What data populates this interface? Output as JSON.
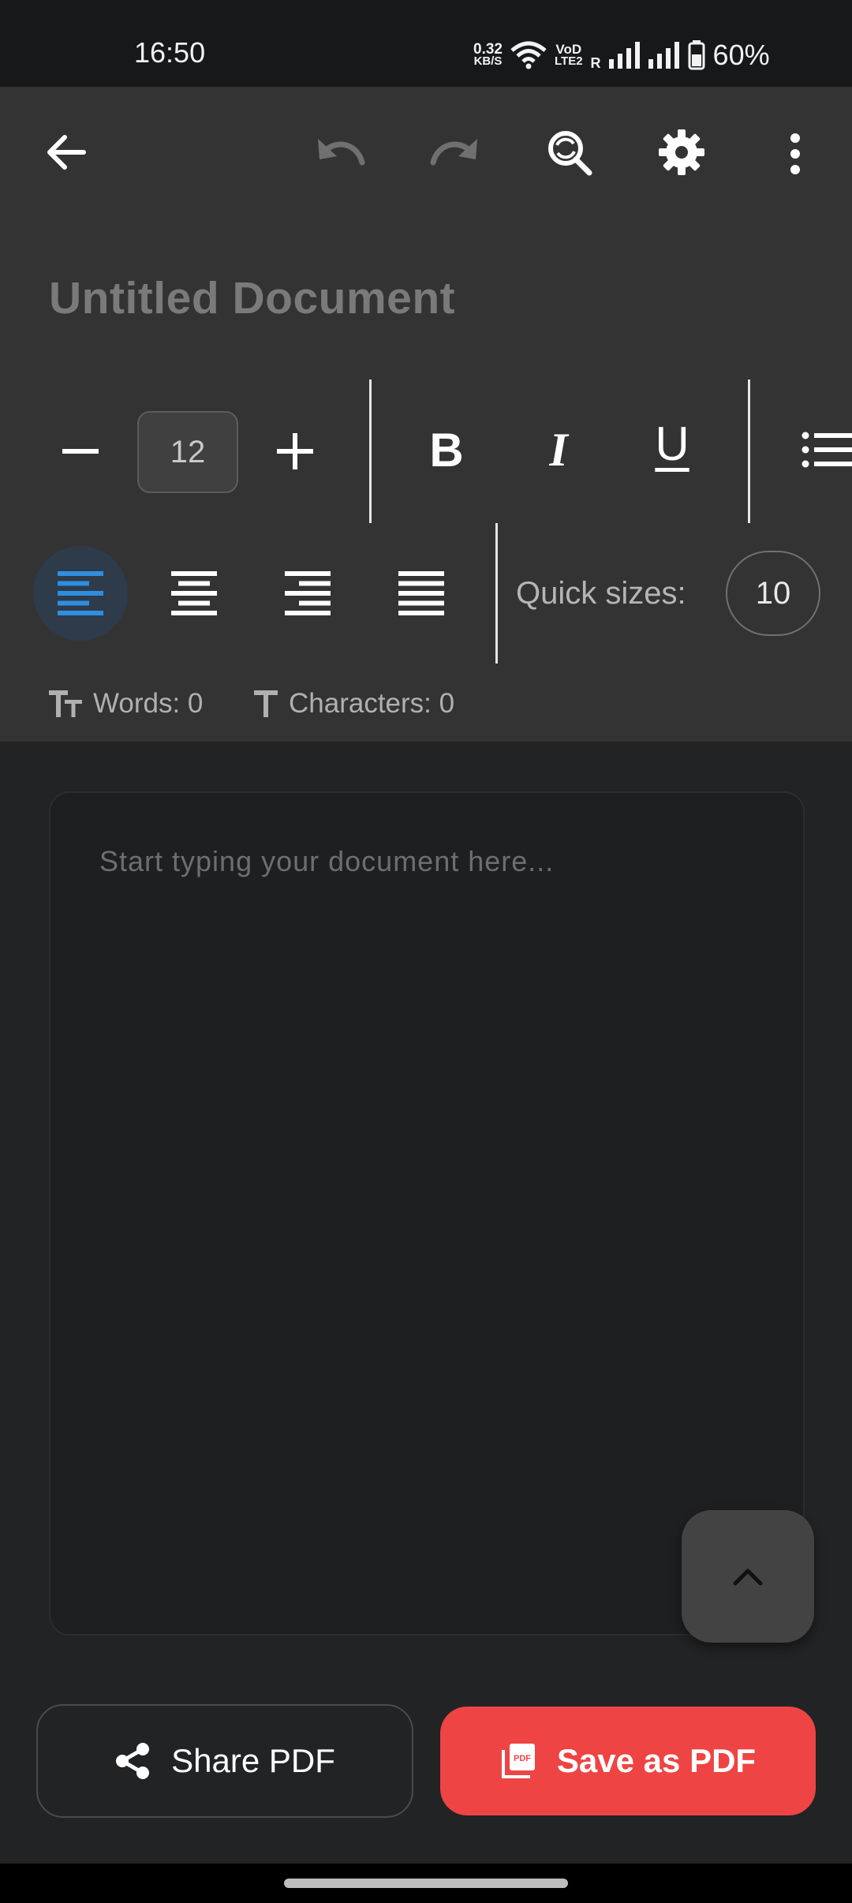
{
  "status_bar": {
    "time": "16:50",
    "net_speed_top": "0.32",
    "net_speed_bottom": "KB/S",
    "volte_top": "VoD",
    "volte_bottom": "LTE2",
    "roaming": "R",
    "battery": "60%"
  },
  "toolbar": {
    "back_icon": "arrow-left-icon",
    "undo_icon": "undo-icon",
    "redo_icon": "redo-icon",
    "find_replace_icon": "find-replace-icon",
    "settings_icon": "gear-icon",
    "more_icon": "more-vertical-icon"
  },
  "document": {
    "title": "Untitled Document",
    "placeholder": "Start typing your document here..."
  },
  "formatting": {
    "font_size": "12",
    "decrease_symbol": "−",
    "increase_symbol": "+",
    "bold": "B",
    "italic": "I",
    "underline": "U",
    "quick_sizes_label": "Quick sizes:",
    "quick_sizes": [
      "10"
    ],
    "alignment_selected": "left"
  },
  "stats": {
    "words": "Words: 0",
    "characters": "Characters: 0"
  },
  "actions": {
    "share_label": "Share PDF",
    "save_label": "Save as PDF"
  },
  "colors": {
    "accent_blue": "#2f8ee0",
    "save_red": "#ee4444"
  }
}
